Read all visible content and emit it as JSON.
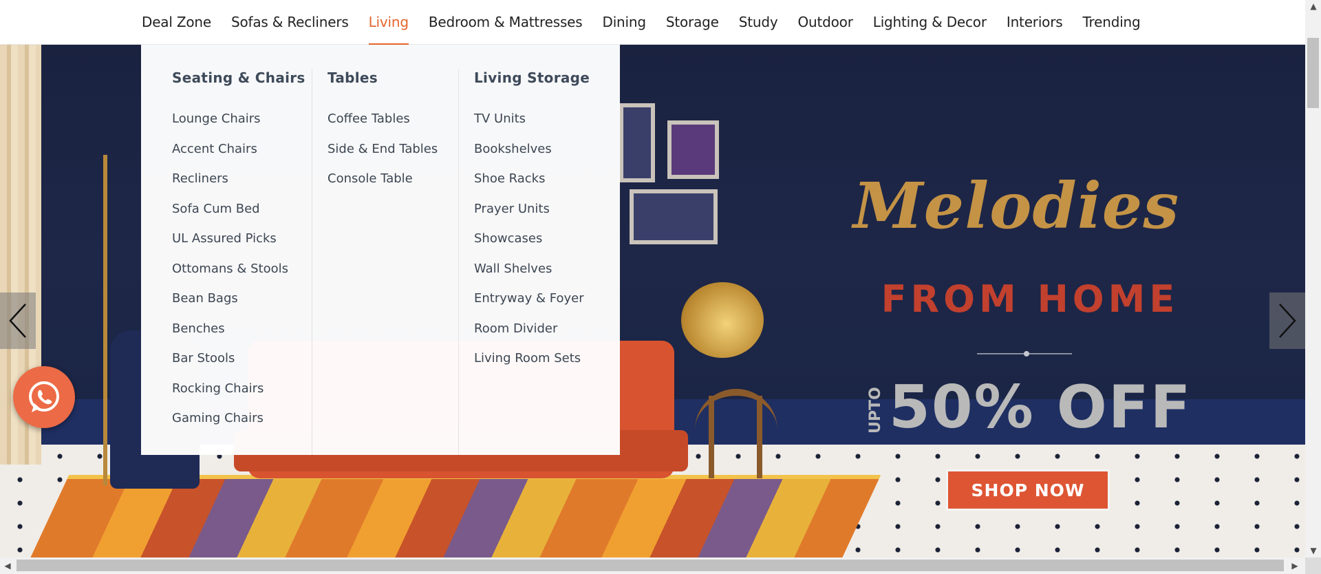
{
  "nav": {
    "items": [
      "Deal Zone",
      "Sofas & Recliners",
      "Living",
      "Bedroom & Mattresses",
      "Dining",
      "Storage",
      "Study",
      "Outdoor",
      "Lighting & Decor",
      "Interiors",
      "Trending"
    ],
    "active": "Living"
  },
  "menu": {
    "columns": [
      {
        "title": "Seating & Chairs",
        "items": [
          "Lounge Chairs",
          "Accent Chairs",
          "Recliners",
          "Sofa Cum Bed",
          "UL Assured Picks",
          "Ottomans & Stools",
          "Bean Bags",
          "Benches",
          "Bar Stools",
          "Rocking Chairs",
          "Gaming Chairs"
        ]
      },
      {
        "title": "Tables",
        "items": [
          "Coffee Tables",
          "Side & End Tables",
          "Console Table"
        ]
      },
      {
        "title": "Living Storage",
        "items": [
          "TV Units",
          "Bookshelves",
          "Shoe Racks",
          "Prayer Units",
          "Showcases",
          "Wall Shelves",
          "Entryway & Foyer",
          "Room Divider",
          "Living Room Sets"
        ]
      }
    ]
  },
  "banner": {
    "title": "Melodies",
    "subtitle": "FROM HOME",
    "upto": "UPTO",
    "offer": "50% OFF",
    "cta": "SHOP NOW"
  },
  "icons": {
    "prev": "chevron-left-icon",
    "next": "chevron-right-icon",
    "chat": "whatsapp-icon"
  },
  "colors": {
    "accent": "#e5652e",
    "banner_bg": "#1c2540",
    "cta_bg": "#de5533",
    "title_gold": "#c49346",
    "subtitle_red": "#c2402e"
  }
}
